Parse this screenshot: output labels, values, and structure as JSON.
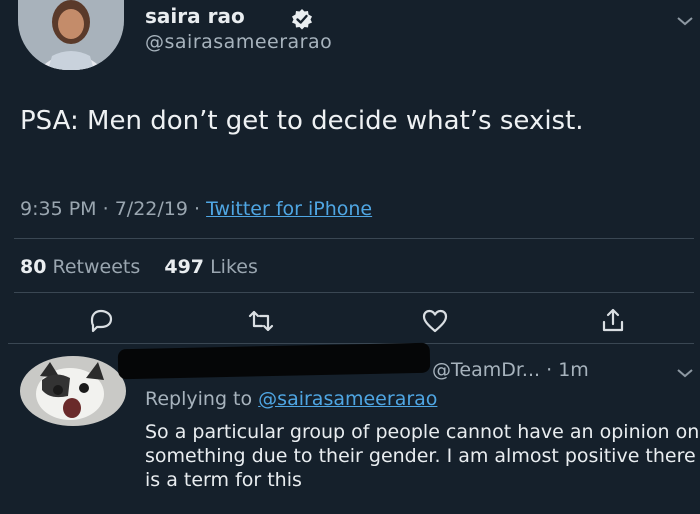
{
  "tweet": {
    "author_name": "saira rao",
    "author_handle": "@sairasameerarao",
    "text": "PSA: Men don’t get to decide what’s sexist.",
    "time": "9:35 PM",
    "date": "7/22/19",
    "source": "Twitter for iPhone",
    "retweets_count": "80",
    "retweets_label": "Retweets",
    "likes_count": "497",
    "likes_label": "Likes"
  },
  "reply": {
    "handle": "@TeamDr...",
    "time": "1m",
    "replying_label": "Replying to",
    "replying_handle": "@sairasameerarao",
    "text": "So a particular group of people cannot have an opinion on something due to their gender. I am almost positive there is a term for this"
  },
  "colors": {
    "background": "#15202b",
    "link": "#4fa6e3",
    "muted": "#9aa6b0"
  },
  "icons": [
    "verified-icon",
    "chevron-down-icon",
    "reply-icon",
    "retweet-icon",
    "like-icon",
    "share-icon"
  ]
}
